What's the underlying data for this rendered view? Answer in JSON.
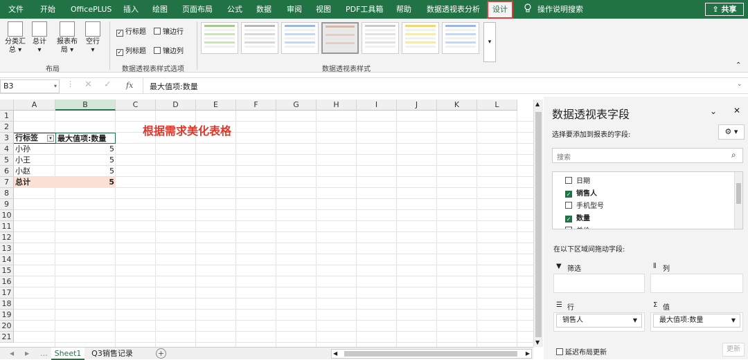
{
  "tabs": [
    "文件",
    "开始",
    "OfficePLUS",
    "插入",
    "绘图",
    "页面布局",
    "公式",
    "数据",
    "审阅",
    "视图",
    "PDF工具箱",
    "帮助",
    "数据透视表分析",
    "设计"
  ],
  "tell_me": "操作说明搜索",
  "share": "共享",
  "ribbon": {
    "layout_buttons": [
      "分类汇总",
      "总计",
      "报表布局",
      "空行"
    ],
    "layout_buttons_l1": [
      "分类汇",
      "总计",
      "报表布",
      "空行"
    ],
    "layout_buttons_l2": [
      "总 ▾",
      "▾",
      "局 ▾",
      "▾"
    ],
    "layout_group": "布局",
    "options": {
      "row_headers": "行标题",
      "col_headers": "列标题",
      "banded_rows": "镶边行",
      "banded_cols": "镶边列"
    },
    "options_group": "数据透视表样式选项",
    "styles_group": "数据透视表样式",
    "style_colors": [
      "#a5c98c",
      "#b8b8b8",
      "#9bb7e0",
      "#e8b09a",
      "#c9c9c9",
      "#f2d675",
      "#9db4e6"
    ]
  },
  "formula_bar": {
    "name_box": "B3",
    "fx": "fx",
    "content": "最大值项:数量"
  },
  "columns": [
    "A",
    "B",
    "C",
    "D",
    "E",
    "F",
    "G",
    "H",
    "I",
    "J",
    "K",
    "L"
  ],
  "rows": [
    "1",
    "2",
    "3",
    "4",
    "5",
    "6",
    "7",
    "8",
    "9",
    "10",
    "11",
    "12",
    "13",
    "14",
    "15",
    "16",
    "17",
    "18",
    "19",
    "20",
    "21"
  ],
  "annotation": "根据需求美化表格",
  "pivot": {
    "header": [
      "行标签",
      "最大值项:数量"
    ],
    "rows": [
      [
        "小孙",
        "5"
      ],
      [
        "小王",
        "5"
      ],
      [
        "小赵",
        "5"
      ]
    ],
    "total": [
      "总计",
      "5"
    ]
  },
  "sheets": [
    "Sheet1",
    "Q3销售记录"
  ],
  "panel": {
    "title": "数据透视表字段",
    "choose": "选择要添加到报表的字段:",
    "search_placeholder": "搜索",
    "fields": [
      {
        "name": "日期",
        "checked": false
      },
      {
        "name": "销售人",
        "checked": true
      },
      {
        "name": "手机型号",
        "checked": false
      },
      {
        "name": "数量",
        "checked": true
      },
      {
        "name": "单价",
        "checked": false
      }
    ],
    "drag_hint": "在以下区域间拖动字段:",
    "filters": "筛选",
    "columns": "列",
    "rows": "行",
    "values": "值",
    "rows_value": "销售人",
    "values_value": "最大值项:数量",
    "defer": "延迟布局更新",
    "update": "更新"
  },
  "colors": {
    "accent": "#217346",
    "annotation": "#e0372b",
    "pivot_total_bg": "#fbe0d6"
  }
}
